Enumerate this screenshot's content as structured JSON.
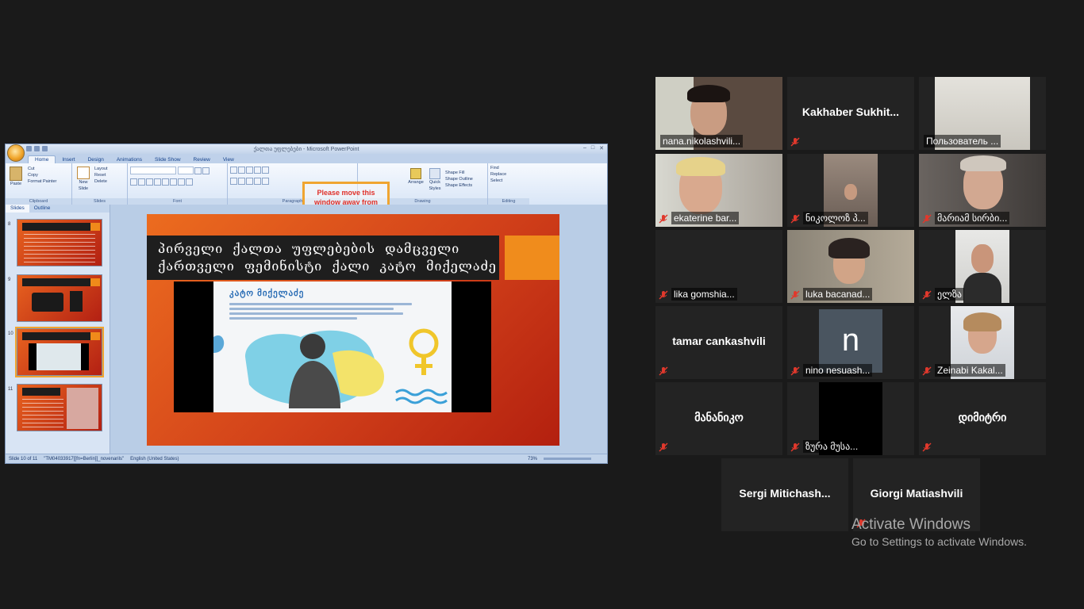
{
  "ppt": {
    "window_title": "ქალთა უფლებები - Microsoft PowerPoint",
    "tabs": [
      "Home",
      "Insert",
      "Design",
      "Animations",
      "Slide Show",
      "Review",
      "View"
    ],
    "ribbon": {
      "clipboard": {
        "paste": "Paste",
        "cut": "Cut",
        "copy": "Copy",
        "format_painter": "Format Painter",
        "label": "Clipboard"
      },
      "slides": {
        "new_slide": "New Slide",
        "layout": "Layout",
        "reset": "Reset",
        "delete": "Delete",
        "label": "Slides"
      },
      "font": {
        "label": "Font"
      },
      "paragraph": {
        "label": "Paragraph"
      },
      "drawing": {
        "arrange": "Arrange",
        "quick_styles": "Quick Styles",
        "shape_fill": "Shape Fill",
        "shape_outline": "Shape Outline",
        "shape_effects": "Shape Effects",
        "label": "Drawing"
      },
      "editing": {
        "find": "Find",
        "replace": "Replace",
        "select": "Select",
        "label": "Editing"
      }
    },
    "share_notice": "Please move this window away from",
    "pane_tabs": [
      "Slides",
      "Outline"
    ],
    "thumb_numbers": [
      "8",
      "9",
      "10",
      "11"
    ],
    "slide_title": "პირველი ქალთა უფლებების დამცველი ქართველი ფემინისტი ქალი კატო მიქელაძე",
    "poster_name": "კატო მიქელაძე",
    "status": {
      "slide": "Slide 10 of 11",
      "theme": "\"TM04033917[[fn=Berlin]]_novenarils\"",
      "language": "English (United States)",
      "zoom": "73%"
    }
  },
  "participants": [
    {
      "name": "nana.nikolashvili...",
      "speaking": true
    },
    {
      "name": "Kakhaber Sukhit..."
    },
    {
      "name": "Пользователь ..."
    },
    {
      "name": "ekaterine bar..."
    },
    {
      "name": "ნიკოლოზ პ..."
    },
    {
      "name": "მარიამ სირბი..."
    },
    {
      "name": "lika gomshia..."
    },
    {
      "name": "luka bacanad..."
    },
    {
      "name": "ელზა"
    },
    {
      "name": "tamar cankashvili"
    },
    {
      "name": "nino nesuash...",
      "avatar_letter": "n"
    },
    {
      "name": "Zeinabi Kakal..."
    },
    {
      "name": "მანანიკო"
    },
    {
      "name": "ზურა მუსა..."
    },
    {
      "name": "დიმიტრი"
    },
    {
      "name": "Sergi Mitichash..."
    },
    {
      "name": "Giorgi Matiashvili"
    }
  ],
  "watermark": {
    "title": "Activate Windows",
    "subtitle": "Go to Settings to activate Windows."
  },
  "colors": {
    "speaking_border": "#b9d44a",
    "muted_icon": "#e0382c",
    "notice_border": "#f0a530"
  }
}
